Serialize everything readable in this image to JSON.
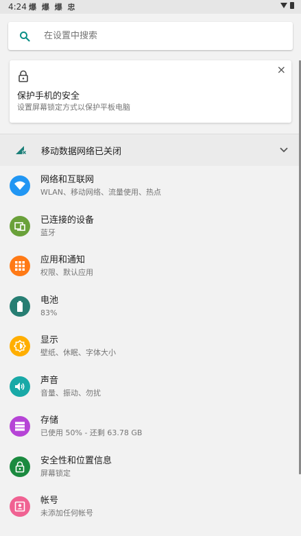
{
  "status_bar": {
    "time": "4:24",
    "notifications": "爆 爆 爆 忠"
  },
  "search": {
    "placeholder": "在设置中搜索"
  },
  "suggestion_card": {
    "title": "保护手机的安全",
    "subtitle": "设置屏幕锁定方式以保护平板电脑",
    "close_label": "×"
  },
  "condition": {
    "label": "移动数据网络已关闭"
  },
  "items": [
    {
      "title": "网络和互联网",
      "subtitle": "WLAN、移动网络、流量使用、热点",
      "icon": "wifi-icon",
      "color": "#2196f3"
    },
    {
      "title": "已连接的设备",
      "subtitle": "蓝牙",
      "icon": "devices-icon",
      "color": "#6aa13a"
    },
    {
      "title": "应用和通知",
      "subtitle": "权限、默认应用",
      "icon": "apps-icon",
      "color": "#ff7a16"
    },
    {
      "title": "电池",
      "subtitle": "83%",
      "icon": "battery-icon",
      "color": "#277e73"
    },
    {
      "title": "显示",
      "subtitle": "壁纸、休眠、字体大小",
      "icon": "brightness-icon",
      "color": "#ffae00"
    },
    {
      "title": "声音",
      "subtitle": "音量、振动、勿扰",
      "icon": "volume-icon",
      "color": "#19a9a7"
    },
    {
      "title": "存储",
      "subtitle": "已使用 50% - 还剩 63.78 GB",
      "icon": "storage-icon",
      "color": "#b644d6"
    },
    {
      "title": "安全性和位置信息",
      "subtitle": "屏幕锁定",
      "icon": "lock-icon",
      "color": "#1b8a3f"
    },
    {
      "title": "帐号",
      "subtitle": "未添加任何帐号",
      "icon": "account-icon",
      "color": "#f06292"
    }
  ]
}
